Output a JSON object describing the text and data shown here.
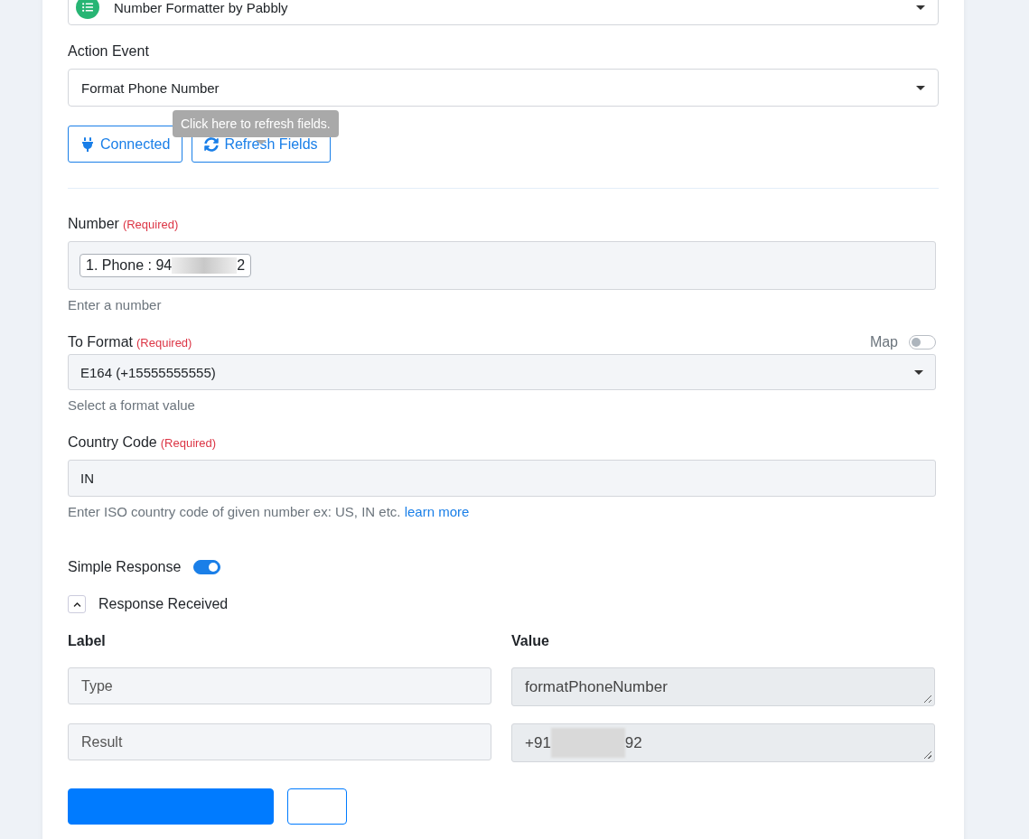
{
  "app_select": {
    "value": "Number Formatter by Pabbly"
  },
  "action_event": {
    "label": "Action Event",
    "value": "Format Phone Number"
  },
  "tooltip": {
    "text": "Click here to refresh fields."
  },
  "buttons": [
    {
      "kind": "connected",
      "label": "Connected"
    },
    {
      "kind": "refresh",
      "label": "Refresh Fields"
    }
  ],
  "fields": [
    {
      "kind": "tag",
      "label": "Number",
      "required": "(Required)",
      "tag_prefix": "1. Phone : 94",
      "tag_suffix": "2",
      "help": "Enter a number"
    },
    {
      "kind": "select",
      "label": "To Format",
      "required": "(Required)",
      "map_label": "Map",
      "map_on": false,
      "value": "E164 (+15555555555)",
      "help": "Select a format value"
    },
    {
      "kind": "text",
      "label": "Country Code",
      "required": "(Required)",
      "value": "IN",
      "help": "Enter ISO country code of given number ex: US, IN etc.",
      "help_link": "learn more"
    }
  ],
  "simple_response": {
    "label": "Simple Response",
    "on": true
  },
  "response": {
    "title": "Response Received",
    "expanded": true,
    "label_heading": "Label",
    "value_heading": "Value",
    "rows": [
      {
        "label": "Type",
        "value_prefix": "formatPhoneNumber",
        "value_suffix": "",
        "masked": false
      },
      {
        "label": "Result",
        "value_prefix": "+91",
        "value_suffix": "92",
        "masked": true
      }
    ]
  },
  "bottom_buttons": [
    {
      "kind": "primary"
    },
    {
      "kind": "outline"
    }
  ]
}
